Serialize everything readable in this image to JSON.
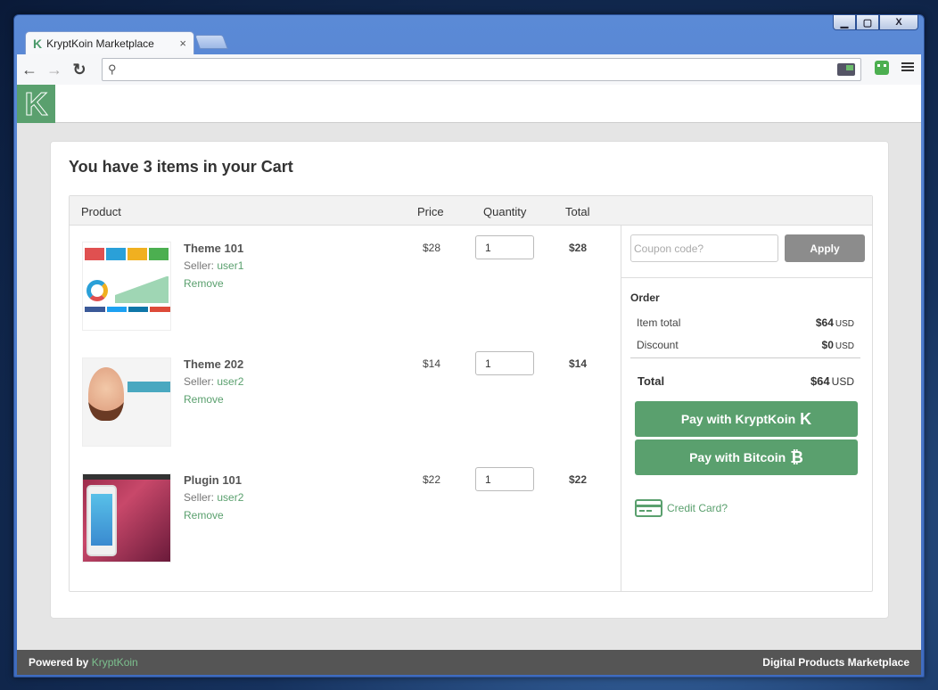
{
  "browser": {
    "tab_title": "KryptKoin Marketplace",
    "tab_close": "×",
    "url": "",
    "window_controls": {
      "minimize": "▁",
      "maximize": "▢",
      "close": "X"
    }
  },
  "cart": {
    "title": "You have 3 items in your Cart",
    "columns": {
      "product": "Product",
      "price": "Price",
      "quantity": "Quantity",
      "total": "Total"
    },
    "seller_prefix": "Seller: ",
    "remove_label": "Remove",
    "items": [
      {
        "name": "Theme 101",
        "seller": "user1",
        "price": "$28",
        "qty": "1",
        "total": "$28"
      },
      {
        "name": "Theme 202",
        "seller": "user2",
        "price": "$14",
        "qty": "1",
        "total": "$14"
      },
      {
        "name": "Plugin 101",
        "seller": "user2",
        "price": "$22",
        "qty": "1",
        "total": "$22"
      }
    ]
  },
  "order": {
    "coupon_placeholder": "Coupon code?",
    "apply_label": "Apply",
    "heading": "Order",
    "item_total_label": "Item total",
    "item_total_value": "$64",
    "discount_label": "Discount",
    "discount_value": "$0",
    "currency": "USD",
    "total_label": "Total",
    "total_value": "$64",
    "pay_kryptkoin": "Pay with KryptKoin",
    "pay_bitcoin": "Pay with Bitcoin",
    "credit_card": "Credit Card?"
  },
  "footer": {
    "powered_by": "Powered by ",
    "brand": "KryptKoin",
    "tagline": "Digital Products Marketplace"
  },
  "colors": {
    "accent": "#5aa06e",
    "apply": "#8c8c8c",
    "footer": "#555555"
  },
  "icons": [
    "kryptkoin-logo-icon",
    "back-icon",
    "forward-icon",
    "reload-icon",
    "search-icon",
    "extension-icon",
    "robot-icon",
    "menu-icon",
    "bitcoin-icon",
    "credit-card-icon"
  ]
}
